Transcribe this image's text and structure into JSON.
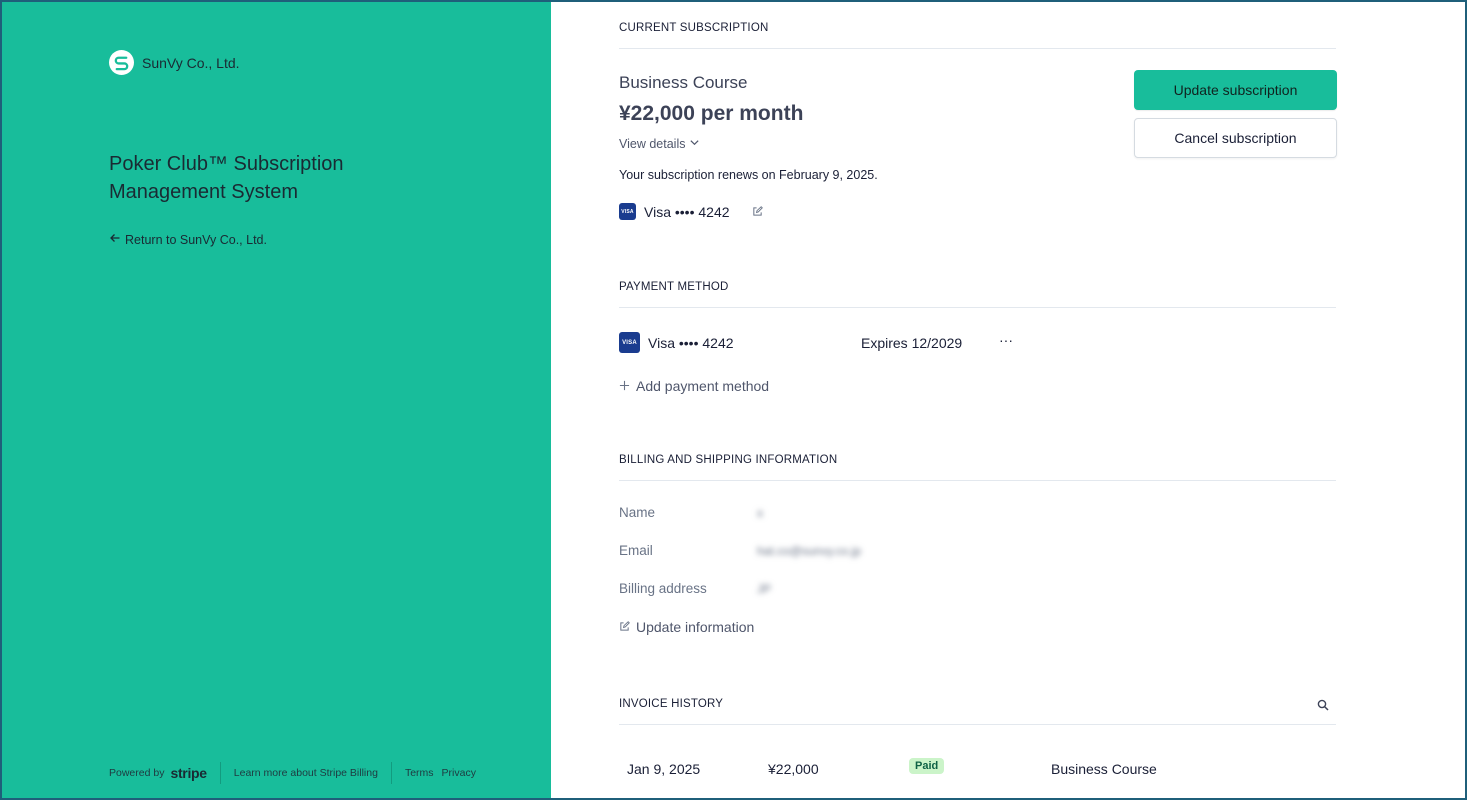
{
  "left": {
    "brand_name": "SunVy Co., Ltd.",
    "product_title": "Poker Club™ Subscription Management System",
    "return_label": "Return to SunVy Co., Ltd.",
    "footer": {
      "powered_by": "Powered by",
      "stripe": "stripe",
      "learn_more": "Learn more about Stripe Billing",
      "terms": "Terms",
      "privacy": "Privacy"
    },
    "accent_color": "#18bd9b"
  },
  "subscription": {
    "heading": "CURRENT SUBSCRIPTION",
    "plan_name": "Business Course",
    "price": "¥22,000 per month",
    "view_details": "View details",
    "renewal_text": "Your subscription renews on February 9, 2025.",
    "card_label": "Visa •••• 4242",
    "update_button": "Update subscription",
    "cancel_button": "Cancel subscription"
  },
  "payment": {
    "heading": "PAYMENT METHOD",
    "card_brand_badge": "VISA",
    "card_label": "Visa •••• 4242",
    "expires": "Expires 12/2029",
    "more": "···",
    "add_method": "Add payment method"
  },
  "billing": {
    "heading": "BILLING AND SHIPPING INFORMATION",
    "name_label": "Name",
    "name_value": "x",
    "email_label": "Email",
    "email_value": "hat.co@sunvy.co.jp",
    "address_label": "Billing address",
    "address_value": "JP",
    "update_info": "Update information"
  },
  "invoices": {
    "heading": "INVOICE HISTORY",
    "rows": [
      {
        "date": "Jan 9, 2025",
        "amount": "¥22,000",
        "status": "Paid",
        "description": "Business Course"
      }
    ]
  }
}
